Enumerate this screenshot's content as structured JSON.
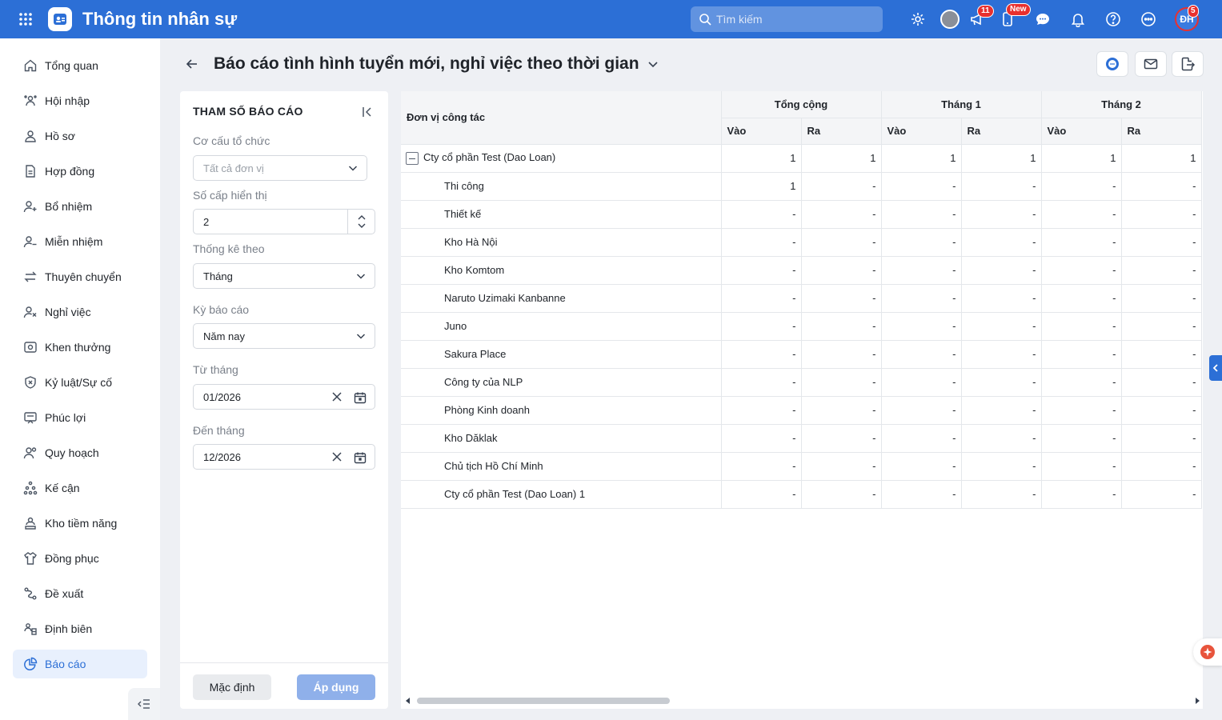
{
  "app": {
    "title": "Thông tin nhân sự",
    "search_placeholder": "Tìm kiếm",
    "badges": {
      "megaphone": "11",
      "phone": "New",
      "avatar": "5"
    },
    "user_initials": "ĐH"
  },
  "sidebar": {
    "items": [
      {
        "label": "Tổng quan",
        "icon": "home-icon"
      },
      {
        "label": "Hội nhập",
        "icon": "users-onboard-icon"
      },
      {
        "label": "Hồ sơ",
        "icon": "user-icon"
      },
      {
        "label": "Hợp đồng",
        "icon": "document-icon"
      },
      {
        "label": "Bổ nhiệm",
        "icon": "user-plus-icon"
      },
      {
        "label": "Miễn nhiệm",
        "icon": "user-minus-icon"
      },
      {
        "label": "Thuyên chuyển",
        "icon": "transfer-icon"
      },
      {
        "label": "Nghỉ việc",
        "icon": "user-x-icon"
      },
      {
        "label": "Khen thưởng",
        "icon": "reward-icon"
      },
      {
        "label": "Kỷ luật/Sự cố",
        "icon": "shield-x-icon"
      },
      {
        "label": "Phúc lợi",
        "icon": "benefit-icon"
      },
      {
        "label": "Quy hoạch",
        "icon": "planning-icon"
      },
      {
        "label": "Kế cận",
        "icon": "org-tree-icon"
      },
      {
        "label": "Kho tiềm năng",
        "icon": "talent-pool-icon"
      },
      {
        "label": "Đồng phục",
        "icon": "shirt-icon"
      },
      {
        "label": "Đề xuất",
        "icon": "proposal-icon"
      },
      {
        "label": "Định biên",
        "icon": "headcount-icon"
      },
      {
        "label": "Báo cáo",
        "icon": "report-icon",
        "active": true
      }
    ]
  },
  "page": {
    "title": "Báo cáo tình hình tuyển mới, nghỉ việc theo thời gian"
  },
  "params": {
    "title": "THAM SỐ BÁO CÁO",
    "org_label": "Cơ cấu tổ chức",
    "org_placeholder": "Tất cả đơn vị",
    "level_label": "Số cấp hiển thị",
    "level_value": "2",
    "stat_label": "Thống kê theo",
    "stat_value": "Tháng",
    "period_label": "Kỳ báo cáo",
    "period_value": "Năm nay",
    "from_label": "Từ tháng",
    "from_value": "01/2026",
    "to_label": "Đến tháng",
    "to_value": "12/2026",
    "default_btn": "Mặc định",
    "apply_btn": "Áp dụng"
  },
  "table": {
    "unit_header": "Đơn vị công tác",
    "groups": [
      "Tổng cộng",
      "Tháng 1",
      "Tháng 2"
    ],
    "sub_in": "Vào",
    "sub_out": "Ra",
    "rows": [
      {
        "name": "Cty cổ phần Test (Dao Loan)",
        "values": [
          "1",
          "1",
          "1",
          "1",
          "1",
          "1"
        ],
        "parent": true
      },
      {
        "name": "Thi công",
        "values": [
          "1",
          "-",
          "-",
          "-",
          "-",
          "-"
        ]
      },
      {
        "name": "Thiết kế",
        "values": [
          "-",
          "-",
          "-",
          "-",
          "-",
          "-"
        ]
      },
      {
        "name": "Kho Hà Nội",
        "values": [
          "-",
          "-",
          "-",
          "-",
          "-",
          "-"
        ]
      },
      {
        "name": "Kho Komtom",
        "values": [
          "-",
          "-",
          "-",
          "-",
          "-",
          "-"
        ]
      },
      {
        "name": "Naruto Uzimaki Kanbanne",
        "values": [
          "-",
          "-",
          "-",
          "-",
          "-",
          "-"
        ]
      },
      {
        "name": "Juno",
        "values": [
          "-",
          "-",
          "-",
          "-",
          "-",
          "-"
        ]
      },
      {
        "name": "Sakura Place",
        "values": [
          "-",
          "-",
          "-",
          "-",
          "-",
          "-"
        ]
      },
      {
        "name": "Công ty của NLP",
        "values": [
          "-",
          "-",
          "-",
          "-",
          "-",
          "-"
        ]
      },
      {
        "name": "Phòng Kinh doanh",
        "values": [
          "-",
          "-",
          "-",
          "-",
          "-",
          "-"
        ]
      },
      {
        "name": "Kho Dăklak",
        "values": [
          "-",
          "-",
          "-",
          "-",
          "-",
          "-"
        ]
      },
      {
        "name": "Chủ tịch Hồ Chí Minh",
        "values": [
          "-",
          "-",
          "-",
          "-",
          "-",
          "-"
        ]
      },
      {
        "name": "Cty cổ phần Test (Dao Loan) 1",
        "values": [
          "-",
          "-",
          "-",
          "-",
          "-",
          "-"
        ]
      }
    ]
  },
  "colors": {
    "brand": "#2c6fd6",
    "badge": "#e8302f",
    "apply_disabled": "#8fb0ea"
  }
}
